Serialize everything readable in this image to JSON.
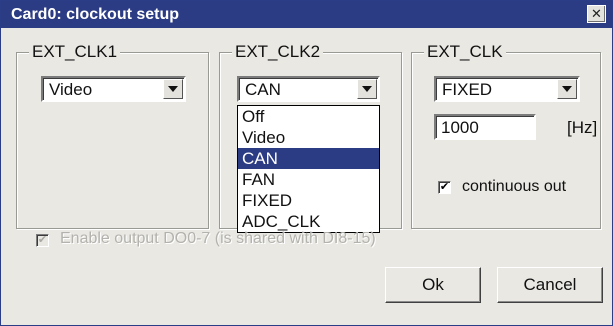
{
  "window": {
    "title": "Card0: clockout setup",
    "close_glyph": "✕"
  },
  "groups": {
    "ext_clk1": {
      "label": "EXT_CLK1",
      "value": "Video"
    },
    "ext_clk2": {
      "label": "EXT_CLK2",
      "value": "CAN",
      "options": [
        "Off",
        "Video",
        "CAN",
        "FAN",
        "FIXED",
        "ADC_CLK"
      ],
      "selected_index": 2
    },
    "ext_clk": {
      "label": "EXT_CLK",
      "value": "FIXED",
      "frequency_value": "1000",
      "frequency_unit": "[Hz]",
      "continuous_out_label": "continuous out",
      "continuous_out_checked": true
    }
  },
  "enable_output": {
    "label": "Enable output DO0-7 (is shared with DI8-15)",
    "checked": true,
    "disabled": true
  },
  "buttons": {
    "ok_label": "Ok",
    "cancel_label": "Cancel"
  },
  "colors": {
    "titlebar": "#2c3c84",
    "selection": "#2c3c84",
    "face": "#e9e8e3"
  }
}
